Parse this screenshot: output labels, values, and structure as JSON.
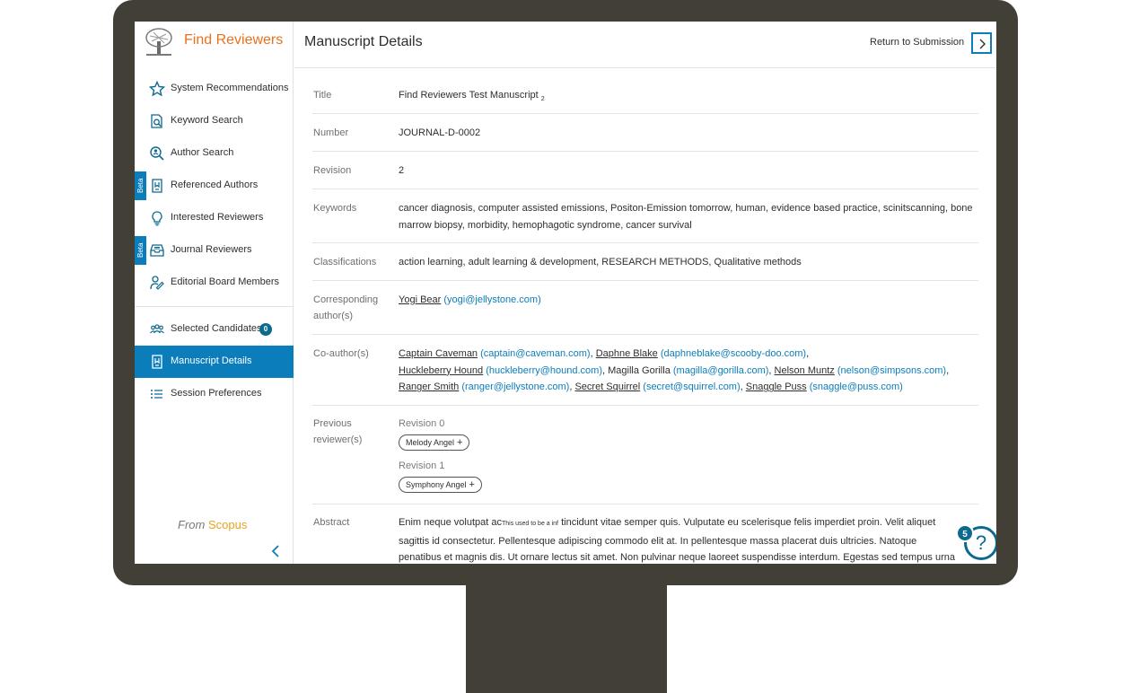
{
  "app": {
    "title": "Find Reviewers",
    "from_label": "From",
    "scopus_label": "Scopus"
  },
  "nav": {
    "items": [
      {
        "label": "System Recommendations",
        "icon": "star-icon"
      },
      {
        "label": "Keyword Search",
        "icon": "document-search-icon"
      },
      {
        "label": "Author Search",
        "icon": "magnifier-person-icon"
      },
      {
        "label": "Referenced Authors",
        "icon": "referenced-document-icon",
        "badge": "Beta"
      },
      {
        "label": "Interested Reviewers",
        "icon": "lightbulb-icon"
      },
      {
        "label": "Journal Reviewers",
        "icon": "journal-inbox-icon",
        "badge": "Beta"
      },
      {
        "label": "Editorial Board Members",
        "icon": "person-pen-icon"
      }
    ],
    "secondary": [
      {
        "label": "Selected Candidates",
        "count": "0",
        "icon": "people-group-icon"
      },
      {
        "label": "Manuscript Details",
        "icon": "manuscript-icon",
        "active": true
      },
      {
        "label": "Session Preferences",
        "icon": "list-icon"
      }
    ]
  },
  "header": {
    "title": "Manuscript Details",
    "return_label": "Return to Submission"
  },
  "details": {
    "title_label": "Title",
    "title_value": "Find Reviewers Test Manuscript",
    "title_sub": "2",
    "number_label": "Number",
    "number_value": "JOURNAL-D-0002",
    "revision_label": "Revision",
    "revision_value": "2",
    "keywords_label": "Keywords",
    "keywords_value": "cancer diagnosis, computer assisted emissions, Positon-Emission tomorrow, human, evidence based practice, scinitscanning, bone marrow biopsy, morbidity, hemophagotic syndrome, cancer survival",
    "classifications_label": "Classifications",
    "classifications_value": "action learning, adult learning & development, RESEARCH METHODS, Qualitative methods",
    "corresponding_label": "Corresponding author(s)",
    "corresponding": {
      "name": "Yogi Bear",
      "email": "(yogi@jellystone.com)"
    },
    "coauthors_label": "Co-author(s)",
    "coauthors": [
      {
        "name": "Captain Caveman",
        "email": "(captain@caveman.com)",
        "linked": true
      },
      {
        "name": "Daphne Blake",
        "email": "(daphneblake@scooby-doo.com)",
        "linked": true
      },
      {
        "name": "Huckleberry Hound",
        "email": "(huckleberry@hound.com)",
        "linked": true
      },
      {
        "name": "Magilla Gorilla",
        "email": "(magilla@gorilla.com)",
        "linked": false
      },
      {
        "name": "Nelson Muntz",
        "email": "(nelson@simpsons.com)",
        "linked": true
      },
      {
        "name": "Ranger Smith",
        "email": "(ranger@jellystone.com)",
        "linked": true
      },
      {
        "name": "Secret Squirrel",
        "email": "(secret@squirrel.com)",
        "linked": true
      },
      {
        "name": "Snaggle Puss",
        "email": "(snaggle@puss.com)",
        "linked": true
      }
    ],
    "previous_label": "Previous reviewer(s)",
    "previous": [
      {
        "revision": "Revision 0",
        "reviewer": "Melody Angel"
      },
      {
        "revision": "Revision 1",
        "reviewer": "Symphony Angel"
      }
    ],
    "abstract_label": "Abstract",
    "abstract_pre": "Enim neque volutpat ac",
    "abstract_small": "This used to be a inf",
    "abstract_post": " tincidunt vitae semper quis. Vulputate eu scelerisque felis imperdiet proin. Velit aliquet sagittis id consectetur. Pellentesque adipiscing commodo elit at. In pellentesque massa placerat duis ultricies. Natoque penatibus et magnis dis. Ut ornare lectus sit amet. Non pulvinar neque laoreet suspendisse interdum. Egestas sed tempus urna et pharetra pharetra. Arcu non sodales"
  },
  "help": {
    "glyph": "?",
    "count": "5"
  },
  "colors": {
    "accent": "#0c7dbb",
    "brand": "#e9711c",
    "monitor": "#423f37"
  }
}
